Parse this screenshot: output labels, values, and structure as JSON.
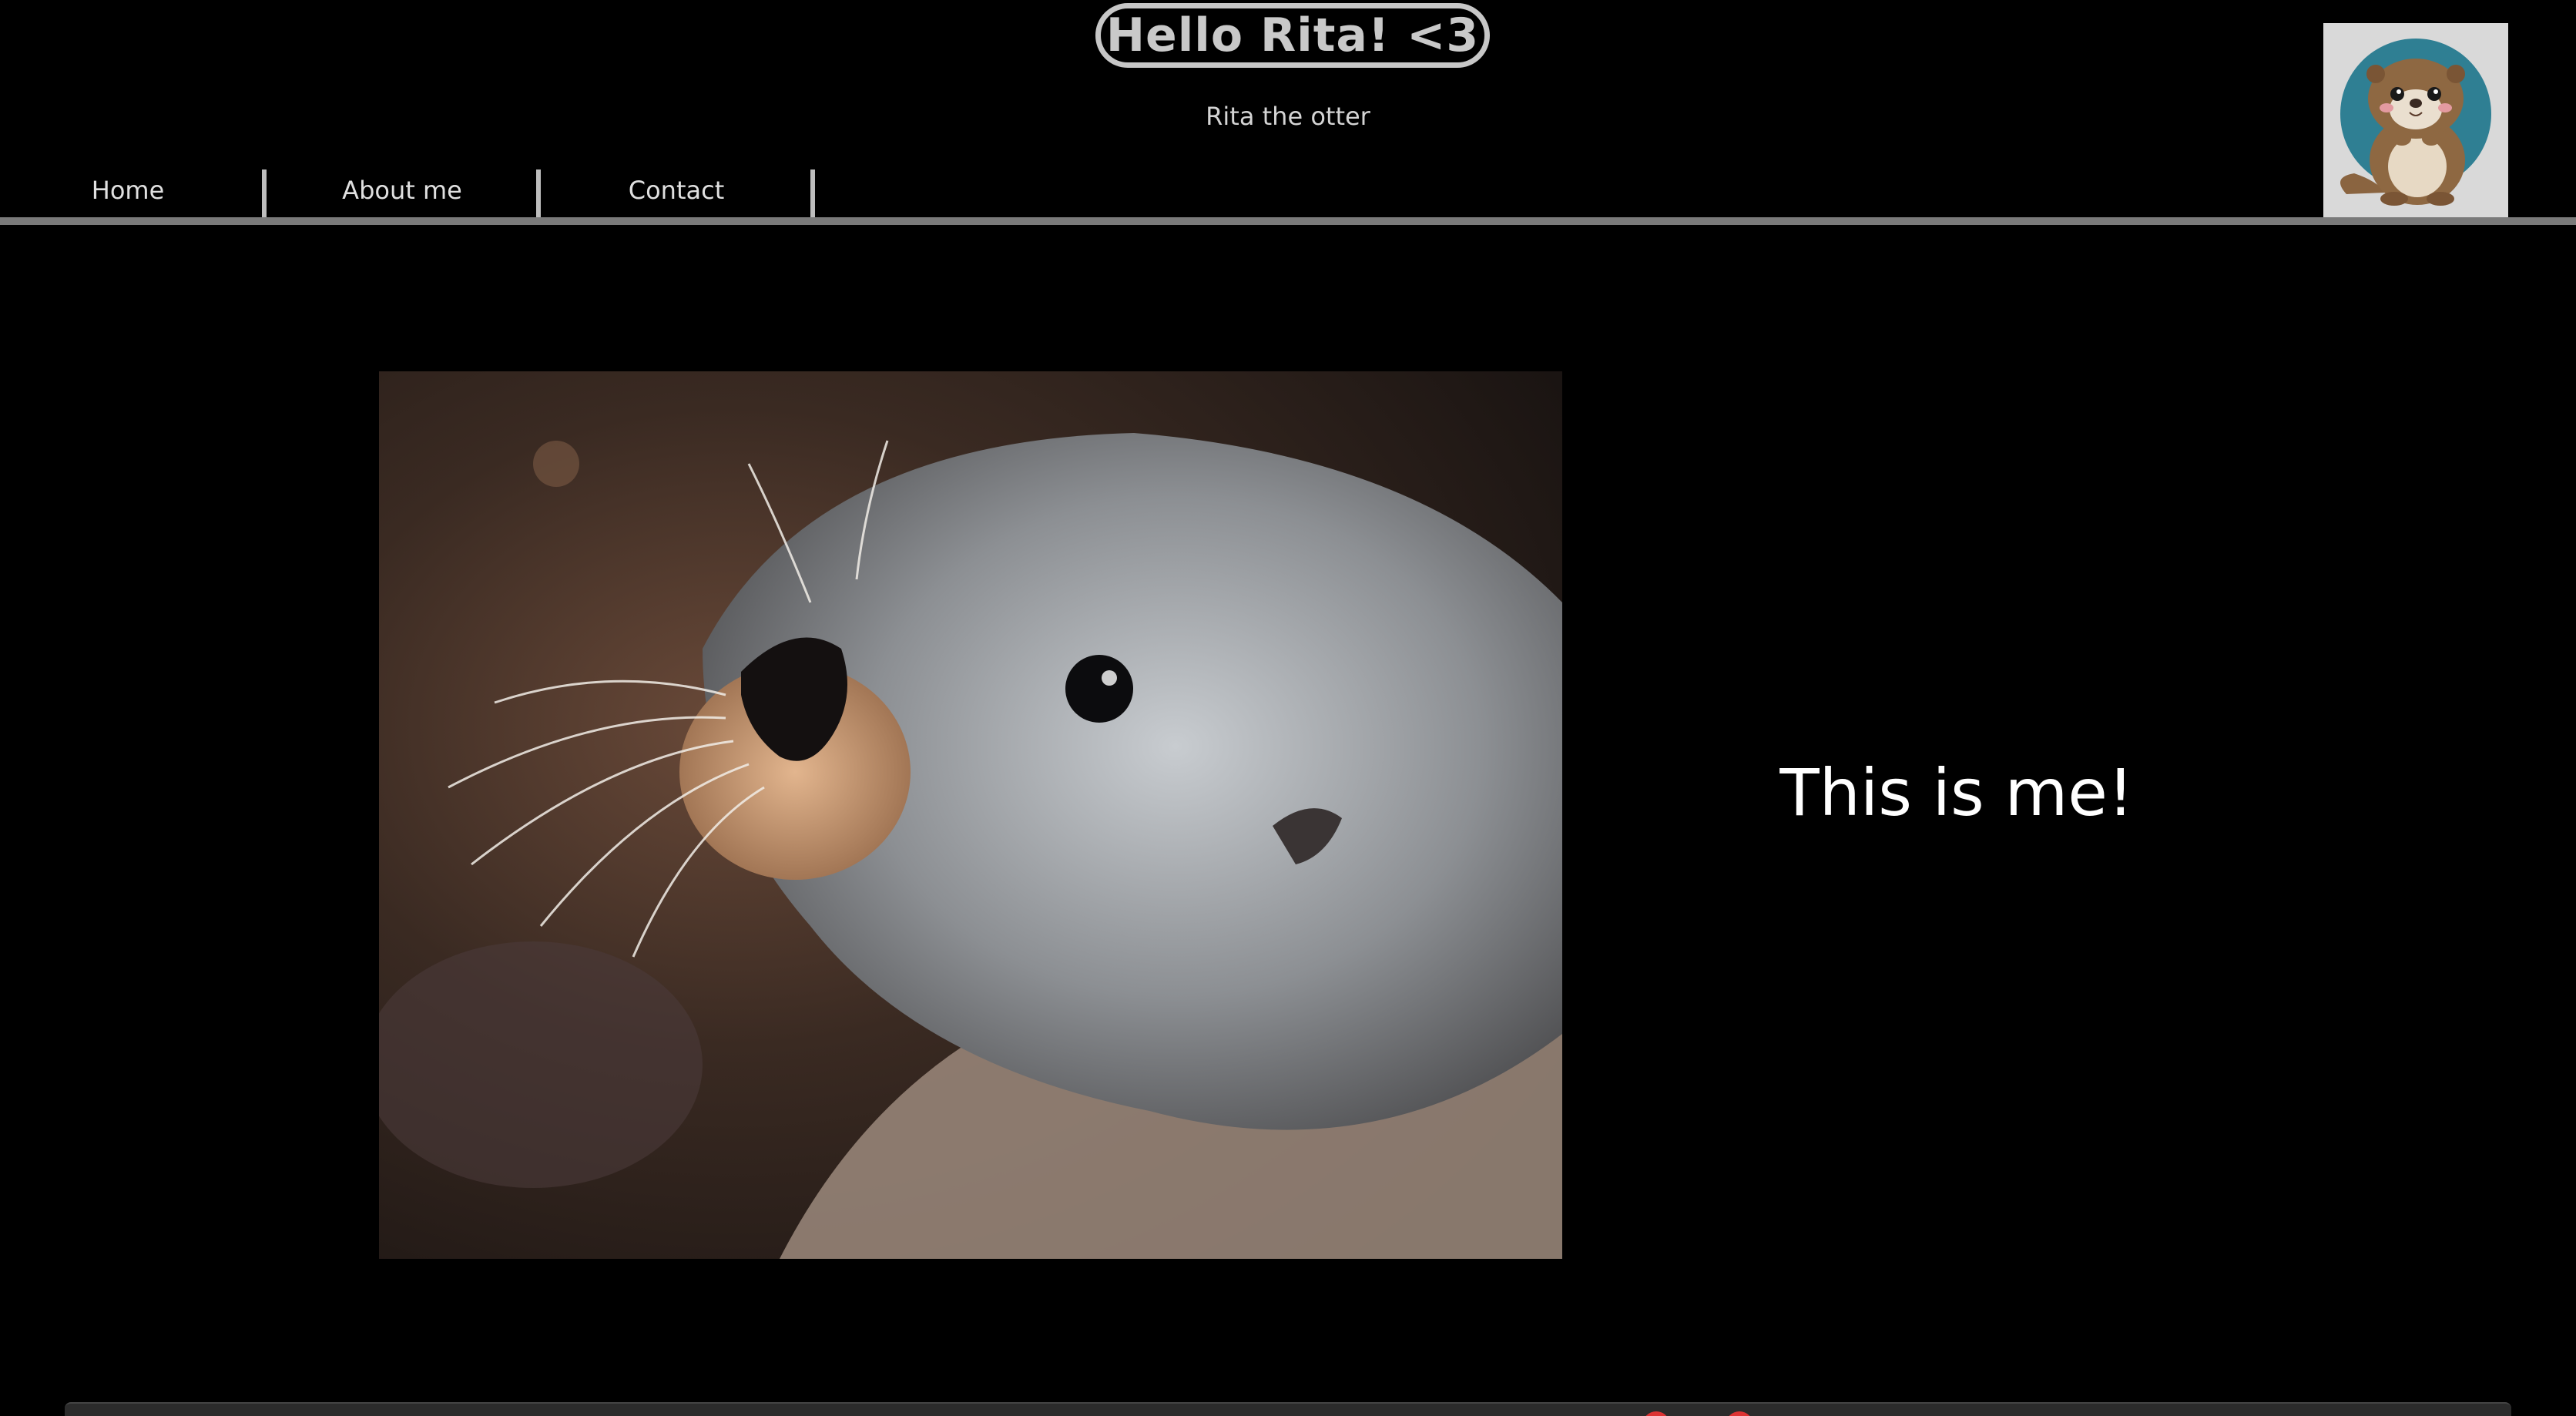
{
  "header": {
    "title": "Hello Rita! <3",
    "subtitle": "Rita the otter"
  },
  "nav": {
    "items": [
      {
        "label": "Home"
      },
      {
        "label": "About me"
      },
      {
        "label": "Contact"
      }
    ]
  },
  "main": {
    "caption": "This is me!"
  },
  "colors": {
    "background": "#000000",
    "title_border": "#c7c7c7",
    "nav_rule": "#7a7a7a"
  },
  "icons": {
    "avatar": "cartoon-otter-avatar",
    "photo": "sea-otter-photo"
  }
}
